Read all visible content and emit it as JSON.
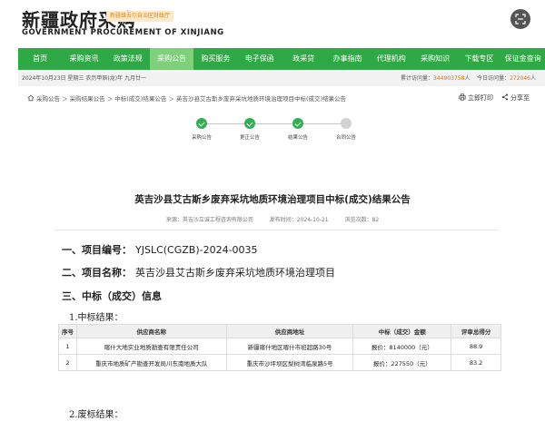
{
  "header": {
    "logo_cn": "新疆政府采购",
    "logo_en": "GOVERNMENT PROCUREMENT OF XINJIANG",
    "notice_tag": "新疆维吾尔自治区财政厅"
  },
  "nav": {
    "items": [
      {
        "label": "首页",
        "active": false
      },
      {
        "label": "采购资讯",
        "active": false
      },
      {
        "label": "政策法规",
        "active": false
      },
      {
        "label": "采购公告",
        "active": true
      },
      {
        "label": "购买服务",
        "active": false
      },
      {
        "label": "电子保函",
        "active": false
      },
      {
        "label": "政采贷",
        "active": false
      },
      {
        "label": "办事指南",
        "active": false
      },
      {
        "label": "代理机构",
        "active": false
      },
      {
        "label": "采购知识",
        "active": false
      },
      {
        "label": "下载专区",
        "active": false
      },
      {
        "label": "保证金查询",
        "active": false
      }
    ]
  },
  "datebar": {
    "date": "2024年10月23日 星期三 农历甲辰(龙)年 九月廿一",
    "total_label": "累计访问量：",
    "total_value": "344903758",
    "total_unit": "人",
    "today_label": "今日访问量：",
    "today_value": "272046",
    "today_unit": "人"
  },
  "breadcrumb": {
    "text": "采购公告 ＞ 采购结果公告 ＞ 中标(成交)结果公告 ＞ 英吉沙县艾古斯乡废弃采坑地质环境治理项目中标(成交)结果公告"
  },
  "tools": {
    "print": "立即打印",
    "share": "分享至"
  },
  "steps": [
    {
      "label": "采购公告",
      "done": true
    },
    {
      "label": "更正公告",
      "done": true
    },
    {
      "label": "结果公告",
      "done": true
    },
    {
      "label": "合同公告",
      "done": false
    }
  ],
  "doc": {
    "title": "英吉沙县艾古斯乡废弃采坑地质环境治理项目中标(成交)结果公告",
    "source": "来源：英吉沙立诚工程咨询有限公司",
    "publish_time": "发布时间：2024-10-21",
    "views": "浏览次数：82"
  },
  "sections": {
    "s1_label": "一、项目编号：",
    "s1_value": "YJSLC(CGZB)-2024-0035",
    "s2_label": "二、项目名称：",
    "s2_value": "英吉沙县艾古斯乡废弃采坑地质环境治理项目",
    "s3_label": "三、中标（成交）信息",
    "sub1": "1.中标结果：",
    "sub2": "2.废标结果："
  },
  "table": {
    "headers": [
      "序号",
      "供应商名称",
      "供应商地址",
      "中标（成交）金额",
      "评审总得分"
    ],
    "rows": [
      [
        "1",
        "喀什大地实业地质勘查有限责任公司",
        "新疆喀什地区喀什市班超路30号",
        "报价：8140000（元）",
        "88.9"
      ],
      [
        "2",
        "重庆市地质矿产勘查开发局川东南地质大队",
        "重庆市沙坪坝区梨树湾临泉路5号",
        "报价：227550（元）",
        "83.2"
      ]
    ]
  },
  "colors": {
    "nav_green": "#2fa846",
    "nav_active": "#7ed07a",
    "step_done": "#35ad55",
    "highlight_orange": "#e07000"
  }
}
